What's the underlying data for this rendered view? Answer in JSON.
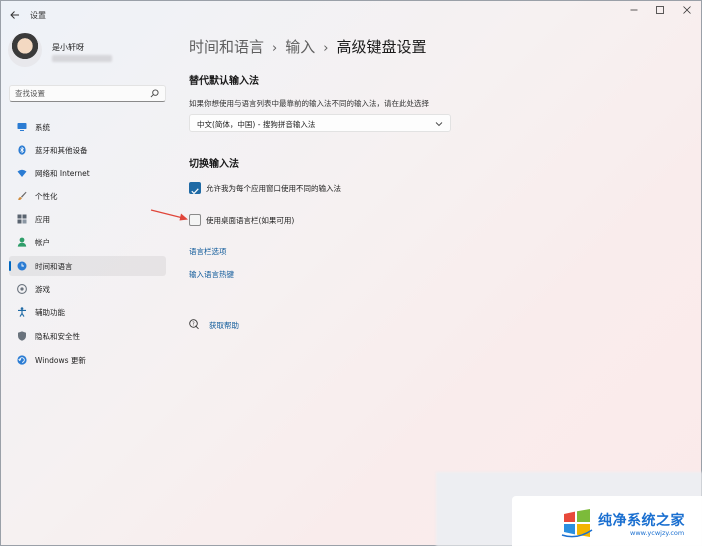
{
  "window": {
    "app_title": "设置",
    "controls": {
      "minimize": "—",
      "maximize": "☐",
      "close": "✕"
    }
  },
  "user": {
    "name": "是小轩呀"
  },
  "search": {
    "placeholder": "查找设置"
  },
  "sidebar": {
    "items": [
      {
        "label": "系统",
        "icon": "monitor-icon",
        "color": "#2b7cd3"
      },
      {
        "label": "蓝牙和其他设备",
        "icon": "bluetooth-icon",
        "color": "#2b7cd3"
      },
      {
        "label": "网络和 Internet",
        "icon": "wifi-icon",
        "color": "#2b7cd3"
      },
      {
        "label": "个性化",
        "icon": "brush-icon",
        "color": "#d08a3a"
      },
      {
        "label": "应用",
        "icon": "apps-icon",
        "color": "#5a6470"
      },
      {
        "label": "帐户",
        "icon": "person-icon",
        "color": "#2f9e6a"
      },
      {
        "label": "时间和语言",
        "icon": "globe-clock-icon",
        "color": "#2b7cd3",
        "selected": true
      },
      {
        "label": "游戏",
        "icon": "gamepad-icon",
        "color": "#6a737d"
      },
      {
        "label": "辅助功能",
        "icon": "accessibility-icon",
        "color": "#1f6aa5"
      },
      {
        "label": "隐私和安全性",
        "icon": "shield-icon",
        "color": "#6a737d"
      },
      {
        "label": "Windows 更新",
        "icon": "update-icon",
        "color": "#2b7cd3"
      }
    ]
  },
  "breadcrumb": {
    "items": [
      "时间和语言",
      "输入",
      "高级键盘设置"
    ],
    "separator": "›"
  },
  "override_section": {
    "title": "替代默认输入法",
    "description": "如果你想使用与语言列表中最靠前的输入法不同的输入法，请在此处选择",
    "dropdown_value": "中文(简体，中国) - 搜狗拼音输入法"
  },
  "switch_section": {
    "title": "切换输入法",
    "options": [
      {
        "label": "允许我为每个应用窗口使用不同的输入法",
        "checked": true
      },
      {
        "label": "使用桌面语言栏(如果可用)",
        "checked": false
      }
    ],
    "links": [
      "语言栏选项",
      "输入语言热键"
    ]
  },
  "help": {
    "label": "获取帮助"
  },
  "annotation": {
    "arrow_color": "#e0453a"
  },
  "watermark": {
    "title": "纯净系统之家",
    "url": "www.ycwjzy.com"
  },
  "colors": {
    "accent": "#0067c0",
    "link": "#0f5a9a",
    "checkbox": "#1f6aa5"
  }
}
